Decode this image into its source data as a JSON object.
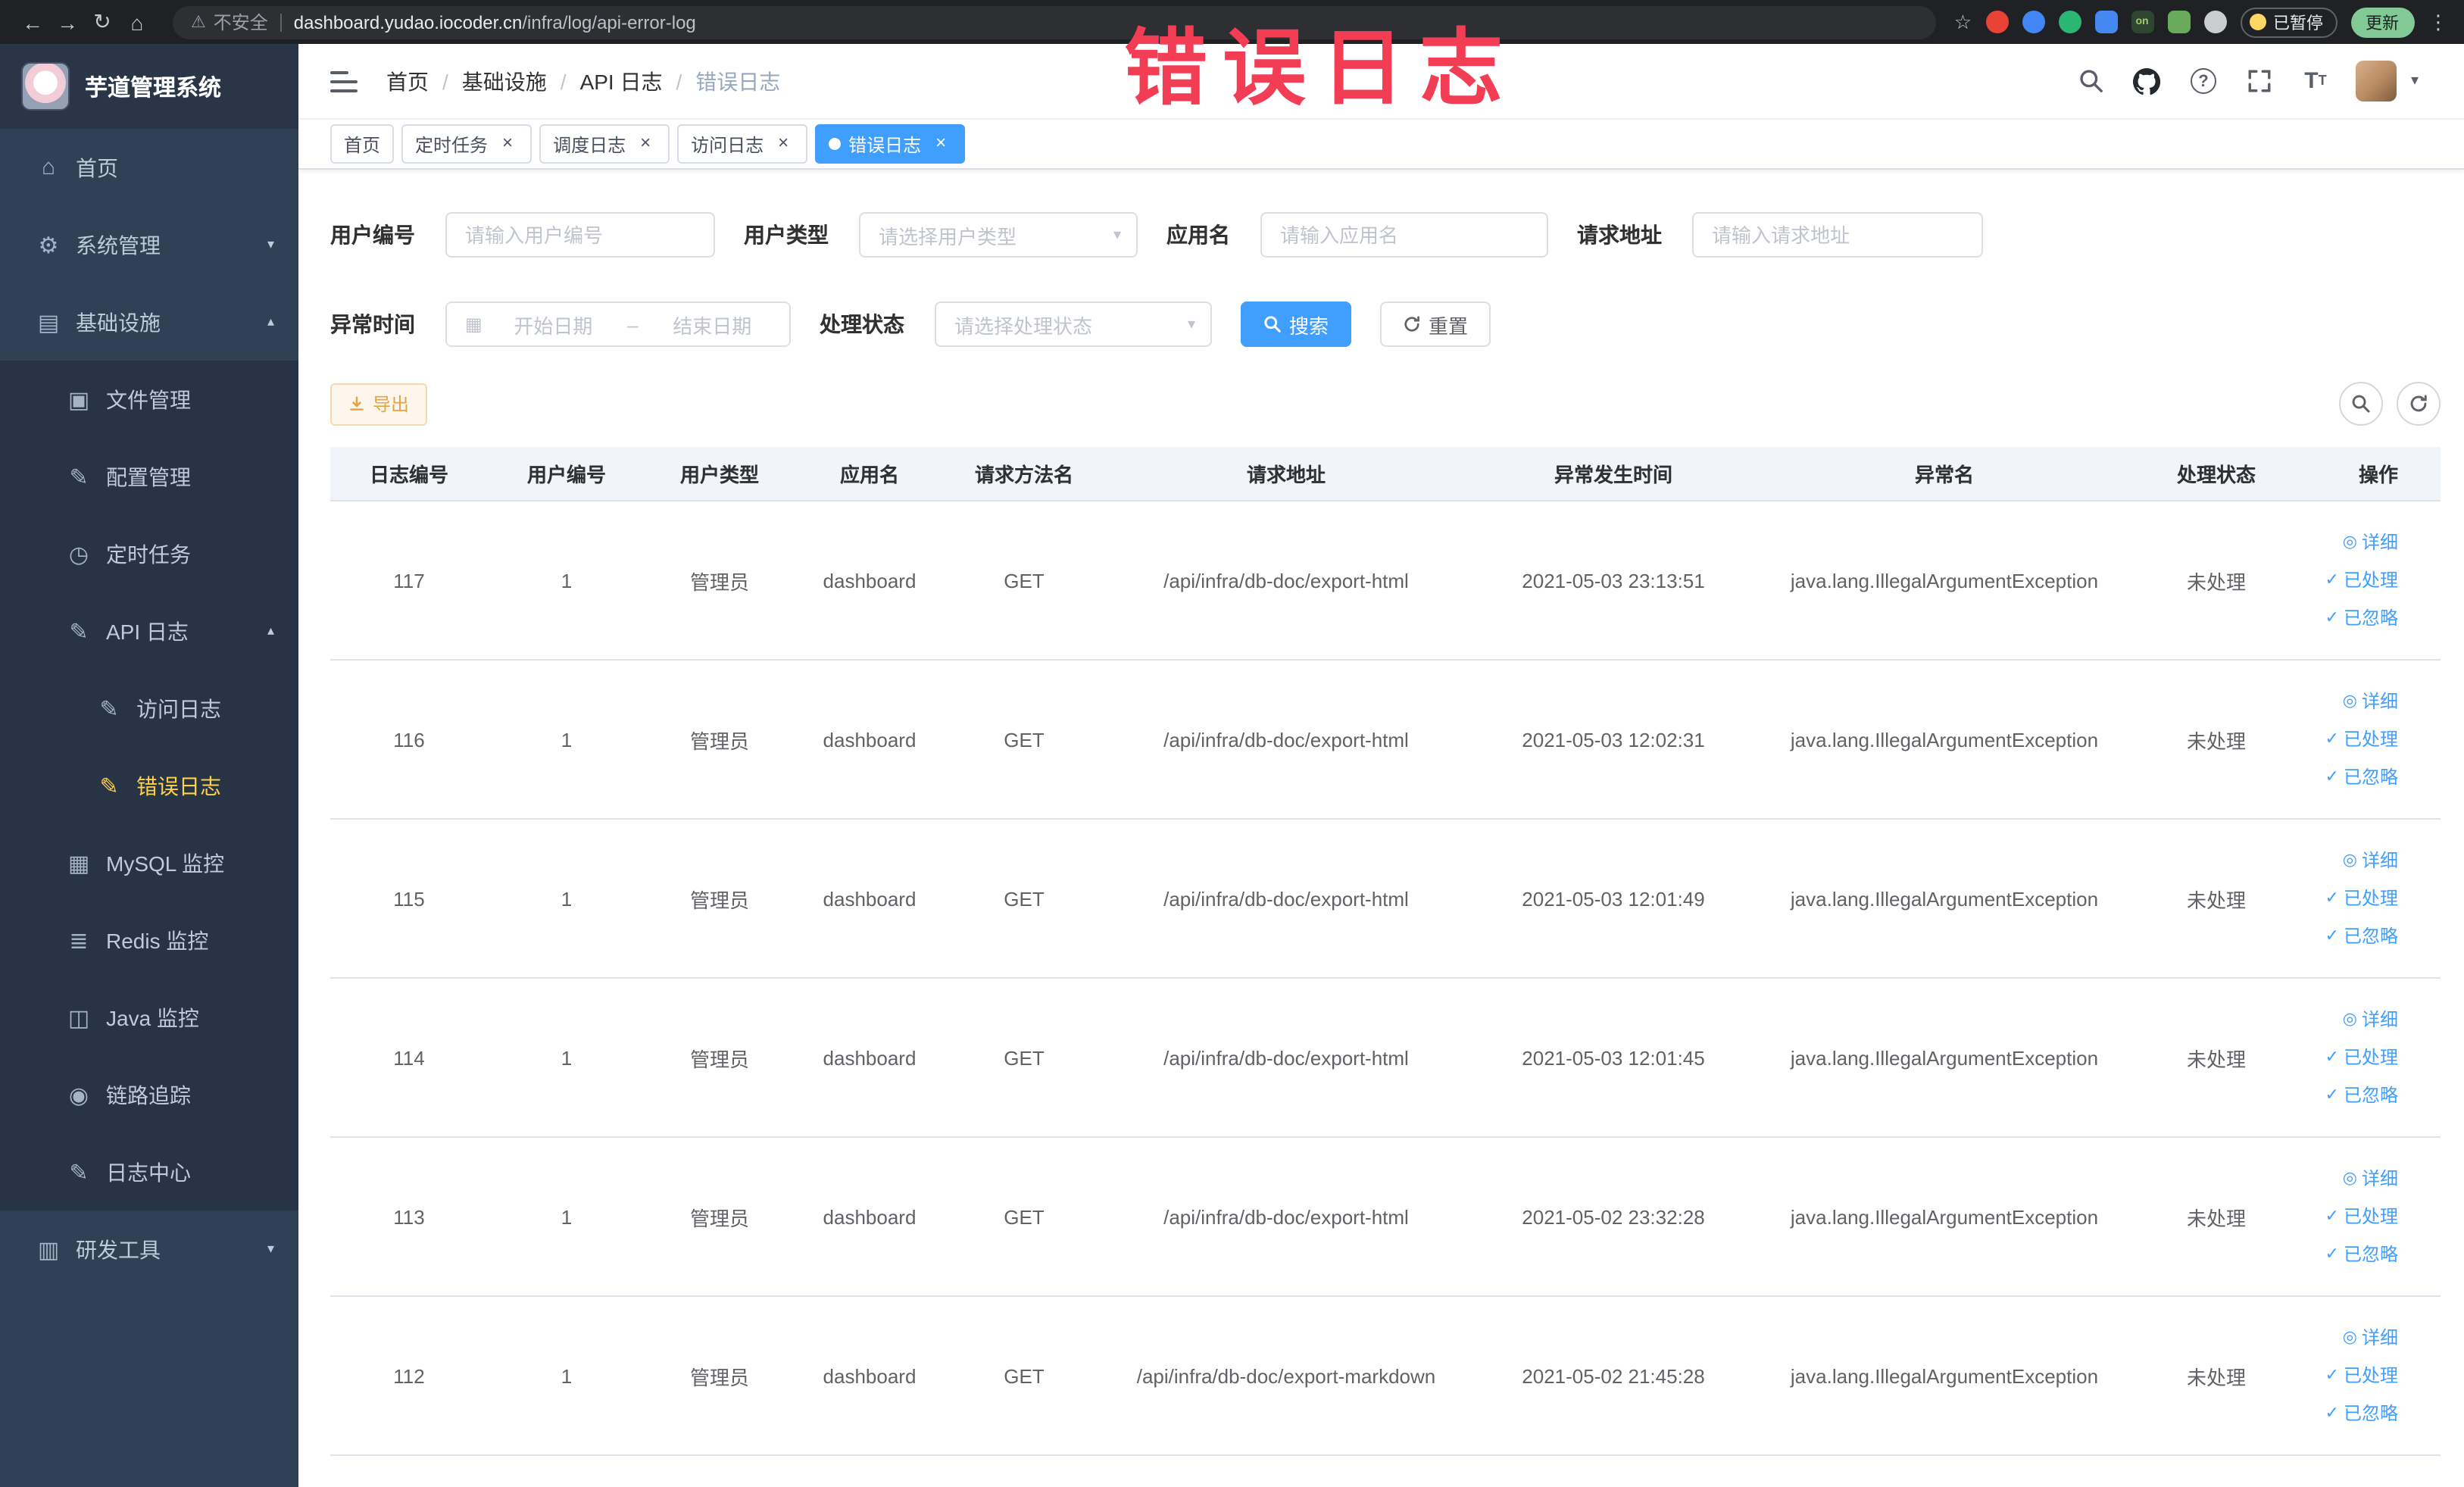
{
  "colors": {
    "accent": "#409eff",
    "sidebar_bg": "#304156",
    "submenu_bg": "#263445",
    "active_menu_text": "#ffd04b",
    "watermark_red": "#f23d54",
    "export_warning": "#e6a23c"
  },
  "watermark": "错误日志",
  "browser": {
    "security_label": "不安全",
    "url_domain": "dashboard.yudao.iocoder.cn",
    "url_path": "/infra/log/api-error-log",
    "paused_label": "已暂停",
    "update_label": "更新",
    "extensions": [
      {
        "name": "extension-red-circle",
        "color": "#ea4335",
        "shape": "circle",
        "text": ""
      },
      {
        "name": "extension-blue-drop",
        "color": "#4285f4",
        "shape": "circle",
        "text": ""
      },
      {
        "name": "extension-green-circle",
        "color": "#2bb673",
        "shape": "circle",
        "text": ""
      },
      {
        "name": "extension-blue-grid",
        "color": "#4688f1",
        "shape": "square",
        "text": ""
      },
      {
        "name": "extension-on-badge",
        "color": "#2e4631",
        "shape": "square",
        "text": "on",
        "text_color": "#9ccc65"
      },
      {
        "name": "extension-green-leaf",
        "color": "#67ab5b",
        "shape": "square",
        "text": ""
      },
      {
        "name": "extension-paw",
        "color": "#caccd0",
        "shape": "circle",
        "text": ""
      }
    ]
  },
  "icon_glyphs": {
    "back": "←",
    "forward": "→",
    "reload": "↻",
    "home": "⌂",
    "warning": "⚠",
    "star": "☆",
    "kebab": "⋮",
    "close": "×",
    "chevron-down": "▾",
    "chevron-up": "▴",
    "caret-down": "▾",
    "calendar": "▦",
    "gear": "⚙",
    "infra": "▤",
    "file": "▣",
    "edit": "✎",
    "clock": "◷",
    "doc": "✎",
    "grid": "▦",
    "layers": "≣",
    "monitor": "◫",
    "eye": "◉",
    "tools": "▥",
    "view": "◎",
    "check": "✓",
    "house": "⌂"
  },
  "sidebar": {
    "logo_title": "芋道管理系统",
    "items": [
      {
        "key": "home",
        "label": "首页",
        "icon": "house",
        "level": 1,
        "sub": false
      },
      {
        "key": "system",
        "label": "系统管理",
        "icon": "gear",
        "level": 1,
        "sub": false,
        "chevron": "down"
      },
      {
        "key": "infra",
        "label": "基础设施",
        "icon": "infra",
        "level": 1,
        "sub": false,
        "chevron": "up"
      },
      {
        "key": "file",
        "label": "文件管理",
        "icon": "file",
        "level": 2,
        "sub": true
      },
      {
        "key": "config",
        "label": "配置管理",
        "icon": "edit",
        "level": 2,
        "sub": true
      },
      {
        "key": "job",
        "label": "定时任务",
        "icon": "clock",
        "level": 2,
        "sub": true
      },
      {
        "key": "api-log",
        "label": "API 日志",
        "icon": "doc",
        "level": 2,
        "sub": true,
        "chevron": "up"
      },
      {
        "key": "access-log",
        "label": "访问日志",
        "icon": "edit",
        "level": 3,
        "sub": true
      },
      {
        "key": "error-log",
        "label": "错误日志",
        "icon": "edit",
        "level": 3,
        "sub": true,
        "active": true
      },
      {
        "key": "mysql",
        "label": "MySQL 监控",
        "icon": "grid",
        "level": 2,
        "sub": true
      },
      {
        "key": "redis",
        "label": "Redis 监控",
        "icon": "layers",
        "level": 2,
        "sub": true
      },
      {
        "key": "java",
        "label": "Java 监控",
        "icon": "monitor",
        "level": 2,
        "sub": true
      },
      {
        "key": "trace",
        "label": "链路追踪",
        "icon": "eye",
        "level": 2,
        "sub": true
      },
      {
        "key": "log-center",
        "label": "日志中心",
        "icon": "edit",
        "level": 2,
        "sub": true
      },
      {
        "key": "dev-tools",
        "label": "研发工具",
        "icon": "tools",
        "level": 1,
        "sub": false,
        "chevron": "down"
      }
    ]
  },
  "header": {
    "breadcrumb": [
      "首页",
      "基础设施",
      "API 日志",
      "错误日志"
    ]
  },
  "tabs": [
    {
      "key": "home",
      "label": "首页",
      "closable": false,
      "active": false
    },
    {
      "key": "job",
      "label": "定时任务",
      "closable": true,
      "active": false
    },
    {
      "key": "job-log",
      "label": "调度日志",
      "closable": true,
      "active": false
    },
    {
      "key": "access-log",
      "label": "访问日志",
      "closable": true,
      "active": false
    },
    {
      "key": "error-log",
      "label": "错误日志",
      "closable": true,
      "active": true
    }
  ],
  "filters": {
    "user_id": {
      "label": "用户编号",
      "placeholder": "请输入用户编号"
    },
    "user_type": {
      "label": "用户类型",
      "placeholder": "请选择用户类型"
    },
    "app_name": {
      "label": "应用名",
      "placeholder": "请输入应用名"
    },
    "request_url": {
      "label": "请求地址",
      "placeholder": "请输入请求地址"
    },
    "exception_time": {
      "label": "异常时间",
      "start_placeholder": "开始日期",
      "separator": "–",
      "end_placeholder": "结束日期"
    },
    "process_status": {
      "label": "处理状态",
      "placeholder": "请选择处理状态"
    },
    "search_label": "搜索",
    "reset_label": "重置"
  },
  "toolbar": {
    "export_label": "导出"
  },
  "table": {
    "columns": [
      "日志编号",
      "用户编号",
      "用户类型",
      "应用名",
      "请求方法名",
      "请求地址",
      "异常发生时间",
      "异常名",
      "处理状态",
      "操作"
    ],
    "row_actions": [
      {
        "key": "detail",
        "label": "详细",
        "icon": "view"
      },
      {
        "key": "done",
        "label": "已处理",
        "icon": "check"
      },
      {
        "key": "ignore",
        "label": "已忽略",
        "icon": "check"
      }
    ],
    "rows": [
      {
        "id": "117",
        "user_id": "1",
        "user_type": "管理员",
        "app": "dashboard",
        "method": "GET",
        "url": "/api/infra/db-doc/export-html",
        "time": "2021-05-03 23:13:51",
        "exception": "java.lang.IllegalArgumentException",
        "status": "未处理"
      },
      {
        "id": "116",
        "user_id": "1",
        "user_type": "管理员",
        "app": "dashboard",
        "method": "GET",
        "url": "/api/infra/db-doc/export-html",
        "time": "2021-05-03 12:02:31",
        "exception": "java.lang.IllegalArgumentException",
        "status": "未处理"
      },
      {
        "id": "115",
        "user_id": "1",
        "user_type": "管理员",
        "app": "dashboard",
        "method": "GET",
        "url": "/api/infra/db-doc/export-html",
        "time": "2021-05-03 12:01:49",
        "exception": "java.lang.IllegalArgumentException",
        "status": "未处理"
      },
      {
        "id": "114",
        "user_id": "1",
        "user_type": "管理员",
        "app": "dashboard",
        "method": "GET",
        "url": "/api/infra/db-doc/export-html",
        "time": "2021-05-03 12:01:45",
        "exception": "java.lang.IllegalArgumentException",
        "status": "未处理"
      },
      {
        "id": "113",
        "user_id": "1",
        "user_type": "管理员",
        "app": "dashboard",
        "method": "GET",
        "url": "/api/infra/db-doc/export-html",
        "time": "2021-05-02 23:32:28",
        "exception": "java.lang.IllegalArgumentException",
        "status": "未处理"
      },
      {
        "id": "112",
        "user_id": "1",
        "user_type": "管理员",
        "app": "dashboard",
        "method": "GET",
        "url": "/api/infra/db-doc/export-markdown",
        "time": "2021-05-02 21:45:28",
        "exception": "java.lang.IllegalArgumentException",
        "status": "未处理"
      }
    ]
  }
}
